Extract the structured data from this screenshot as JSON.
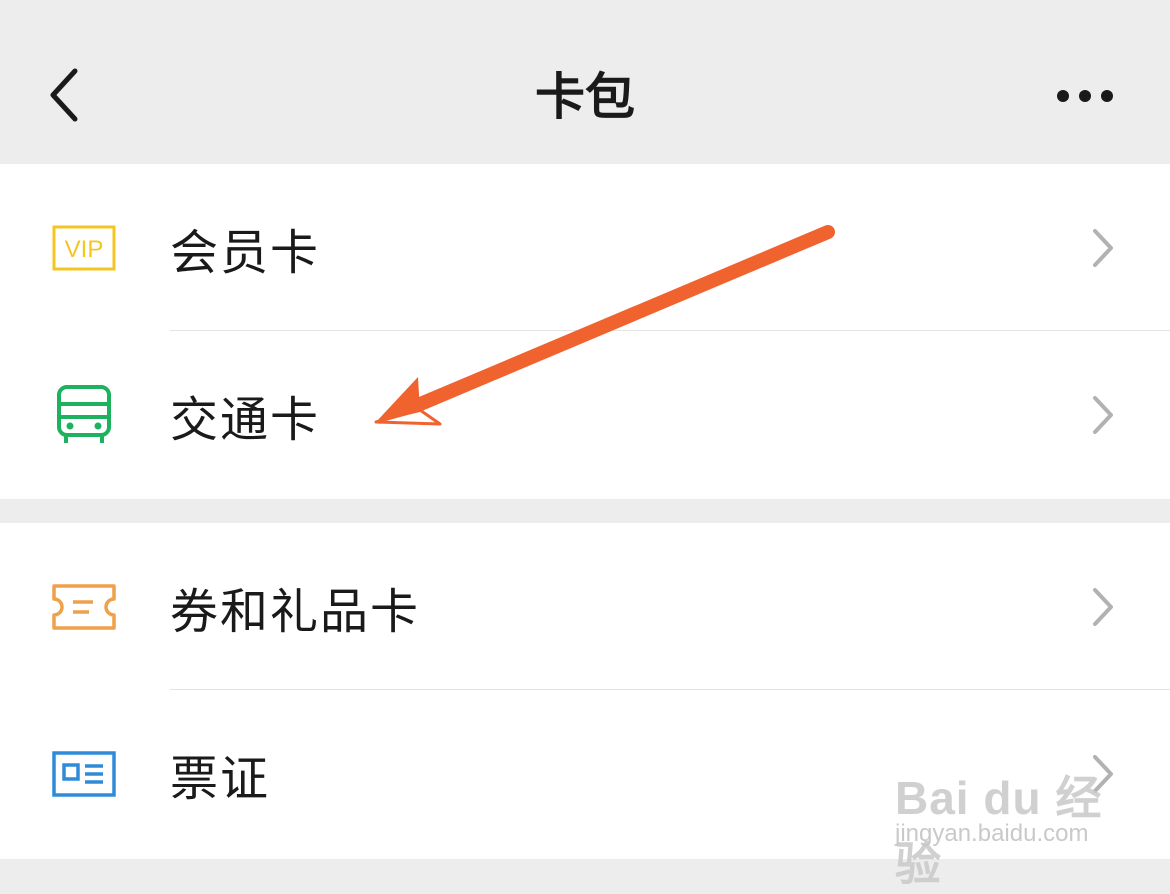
{
  "header": {
    "title": "卡包",
    "back_icon": "chevron-left-icon",
    "more_icon": "more-dots-icon"
  },
  "groups": [
    {
      "items": [
        {
          "label": "会员卡",
          "icon": "vip-card-icon",
          "icon_color": "#F4C622"
        },
        {
          "label": "交通卡",
          "icon": "bus-icon",
          "icon_color": "#1DB25E"
        }
      ]
    },
    {
      "items": [
        {
          "label": "券和礼品卡",
          "icon": "ticket-coupon-icon",
          "icon_color": "#EFA04A"
        },
        {
          "label": "票证",
          "icon": "id-card-icon",
          "icon_color": "#2F8BD8"
        }
      ]
    }
  ],
  "vip_icon_text": "VIP",
  "annotation": {
    "type": "arrow",
    "color": "#F0622E",
    "points_to": "交通卡"
  },
  "watermark": {
    "brand": "Bai du 经验",
    "url": "jingyan.baidu.com"
  }
}
